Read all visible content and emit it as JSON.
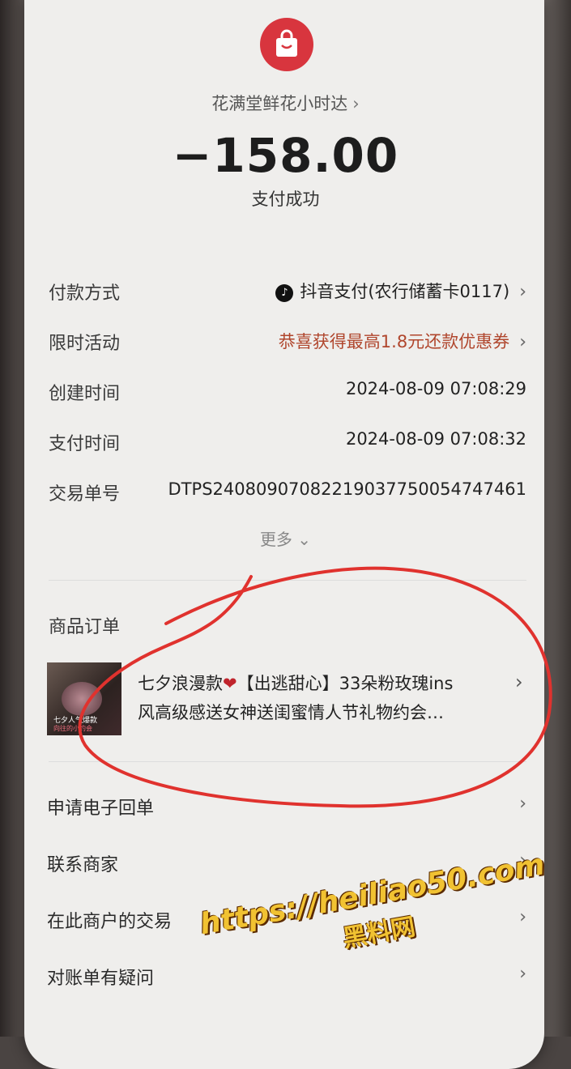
{
  "header": {
    "merchant_name": "花满堂鲜花小时达",
    "amount": "−158.00",
    "status": "支付成功"
  },
  "details": [
    {
      "label": "付款方式",
      "value": "抖音支付(农行储蓄卡0117)"
    },
    {
      "label": "限时活动",
      "value": "恭喜获得最高1.8元还款优惠券"
    },
    {
      "label": "创建时间",
      "value": "2024-08-09 07:08:29"
    },
    {
      "label": "支付时间",
      "value": "2024-08-09 07:08:32"
    },
    {
      "label": "交易单号",
      "value": "DTPS24080907082219037750054747461"
    }
  ],
  "more_label": "更多",
  "order": {
    "section_title": "商品订单",
    "product_title_a": "七夕浪漫款",
    "product_title_b": "【出逃甜心】33朵粉玫瑰ins",
    "product_title_c": "风高级感送女神送闺蜜情人节礼物约会…",
    "thumb_tag": "七夕人气爆款",
    "thumb_tag2": "向往的小约会"
  },
  "menu": [
    {
      "label": "申请电子回单"
    },
    {
      "label": "联系商家"
    },
    {
      "label": "在此商户的交易"
    },
    {
      "label": "对账单有疑问"
    }
  ],
  "watermark": {
    "url": "https://heiliao50.com",
    "name": "黑料网"
  },
  "colors": {
    "accent_red": "#d8353e",
    "promo_text": "#b0462d",
    "annotation_circle": "#e0322e",
    "watermark": "#f1c232"
  },
  "icons": {
    "logo": "shopping-bag-icon",
    "payment": "douyin-icon",
    "chevron": "chevron-right-icon",
    "more": "chevron-down-icon"
  }
}
